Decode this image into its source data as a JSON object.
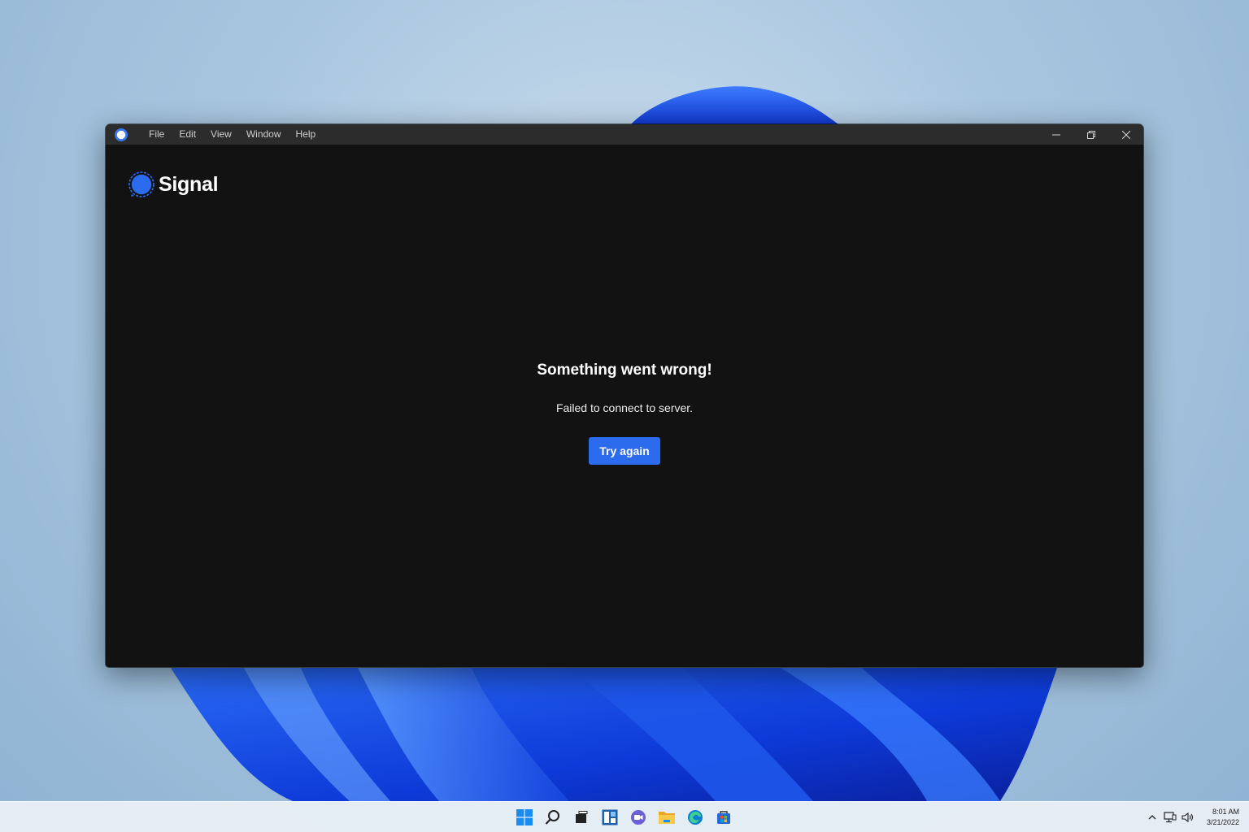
{
  "window": {
    "menu": [
      "File",
      "Edit",
      "View",
      "Window",
      "Help"
    ],
    "brand_name": "Signal",
    "error_title": "Something went wrong!",
    "error_message": "Failed to connect to server.",
    "retry_label": "Try again",
    "controls": [
      "minimize-icon",
      "restore-icon",
      "close-icon"
    ]
  },
  "taskbar": {
    "apps": [
      "windows-start-icon",
      "search-icon",
      "task-view-icon",
      "widgets-icon",
      "chat-icon",
      "file-explorer-icon",
      "edge-browser-icon",
      "store-icon"
    ],
    "tray": [
      "chevron-up-icon",
      "network-icon",
      "volume-icon"
    ],
    "time": "8:01 AM",
    "date": "3/21/2022"
  },
  "colors": {
    "accent": "#2c6bed",
    "window_bg": "#121212",
    "titlebar_bg": "#2c2c2c"
  }
}
